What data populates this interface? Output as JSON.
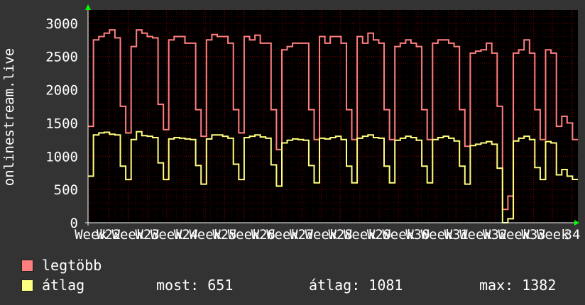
{
  "chart_data": {
    "type": "line",
    "ylabel": "onlinestream.live",
    "ylim": [
      0,
      3200
    ],
    "yticks": [
      0,
      500,
      1000,
      1500,
      2000,
      2500,
      3000
    ],
    "x_tick_labels": [
      "Week",
      "W22",
      "Week",
      "W23",
      "Week",
      "W24",
      "Week",
      "W25",
      "Week",
      "W26",
      "Week",
      "W27",
      "Week",
      "W28",
      "Week",
      "W29",
      "Week",
      "W30",
      "Week",
      "W31",
      "Week",
      "W32",
      "Week",
      "W33",
      "Week",
      "34"
    ],
    "grid": true,
    "colors": {
      "background": "#000000",
      "grid_minor": "#3a0000",
      "grid_major": "#770000",
      "axis": "#00ff00",
      "text": "#ffffff"
    },
    "series": [
      {
        "name": "legtöbb",
        "color": "#ff7f7f",
        "values": [
          1450,
          2750,
          2800,
          2850,
          2900,
          2780,
          1750,
          1350,
          2650,
          2900,
          2850,
          2800,
          2780,
          1780,
          1400,
          2750,
          2800,
          2800,
          2700,
          2700,
          1700,
          1300,
          2750,
          2830,
          2800,
          2800,
          2700,
          1700,
          1350,
          2800,
          2750,
          2820,
          2700,
          2700,
          1700,
          1100,
          2600,
          2650,
          2700,
          2700,
          2700,
          1700,
          1250,
          2800,
          2700,
          2800,
          2800,
          2700,
          1700,
          1250,
          2800,
          2700,
          2850,
          2750,
          2700,
          1700,
          1250,
          2650,
          2700,
          2750,
          2700,
          2650,
          1700,
          1250,
          2700,
          2750,
          2750,
          2700,
          2650,
          1700,
          1150,
          2550,
          2580,
          2600,
          2700,
          2550,
          1750,
          200,
          400,
          2550,
          2600,
          2750,
          2550,
          1700,
          1250,
          2600,
          2550,
          1450,
          1600,
          1500,
          1250
        ],
        "step": "h"
      },
      {
        "name": "átlag",
        "color": "#ffff80",
        "values": [
          700,
          1320,
          1350,
          1360,
          1330,
          1320,
          850,
          650,
          1250,
          1370,
          1310,
          1300,
          1280,
          900,
          650,
          1260,
          1280,
          1270,
          1260,
          1250,
          860,
          580,
          1260,
          1320,
          1320,
          1300,
          1270,
          880,
          650,
          1280,
          1300,
          1320,
          1290,
          1270,
          870,
          550,
          1200,
          1240,
          1260,
          1250,
          1240,
          860,
          600,
          1270,
          1260,
          1280,
          1300,
          1250,
          850,
          600,
          1270,
          1300,
          1320,
          1280,
          1270,
          850,
          600,
          1240,
          1270,
          1300,
          1280,
          1240,
          850,
          600,
          1250,
          1280,
          1300,
          1270,
          1230,
          850,
          580,
          1160,
          1180,
          1200,
          1220,
          1180,
          820,
          0,
          60,
          1230,
          1270,
          1300,
          1250,
          830,
          650,
          1220,
          1200,
          720,
          800,
          700,
          651
        ],
        "step": "h"
      }
    ]
  },
  "legend": {
    "max_label": "legtöbb",
    "avg_label": "átlag"
  },
  "stats": {
    "now": "most: 651",
    "avg": "átlag: 1081",
    "max": "max: 1382"
  }
}
